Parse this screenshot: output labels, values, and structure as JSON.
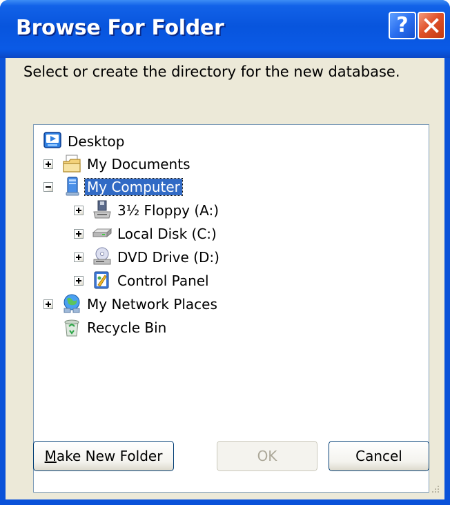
{
  "window": {
    "title": "Browse For Folder",
    "help_glyph": "?",
    "close_icon": "close-icon"
  },
  "dialog": {
    "prompt": "Select or create the directory for the new database."
  },
  "tree": {
    "selected": "My Computer",
    "items": [
      {
        "label": "Desktop",
        "icon": "desktop-icon",
        "expander": "none"
      },
      {
        "label": "My Documents",
        "icon": "my-documents-icon",
        "expander": "plus"
      },
      {
        "label": "My Computer",
        "icon": "my-computer-icon",
        "expander": "minus"
      },
      {
        "label": "3½ Floppy (A:)",
        "icon": "floppy-drive-icon",
        "expander": "plus"
      },
      {
        "label": "Local Disk (C:)",
        "icon": "hard-disk-icon",
        "expander": "plus"
      },
      {
        "label": "DVD Drive (D:)",
        "icon": "dvd-drive-icon",
        "expander": "plus"
      },
      {
        "label": "Control Panel",
        "icon": "control-panel-icon",
        "expander": "plus"
      },
      {
        "label": "My Network Places",
        "icon": "network-places-icon",
        "expander": "plus"
      },
      {
        "label": "Recycle Bin",
        "icon": "recycle-bin-icon",
        "expander": "none"
      }
    ]
  },
  "buttons": {
    "make_new_folder_mnemonic": "M",
    "make_new_folder_rest": "ake New Folder",
    "ok": "OK",
    "cancel": "Cancel",
    "ok_enabled": false
  },
  "colors": {
    "title_bar": "#0a52d9",
    "selection": "#316ac5",
    "dialog_face": "#ece9d8",
    "close_button": "#e0522a"
  }
}
